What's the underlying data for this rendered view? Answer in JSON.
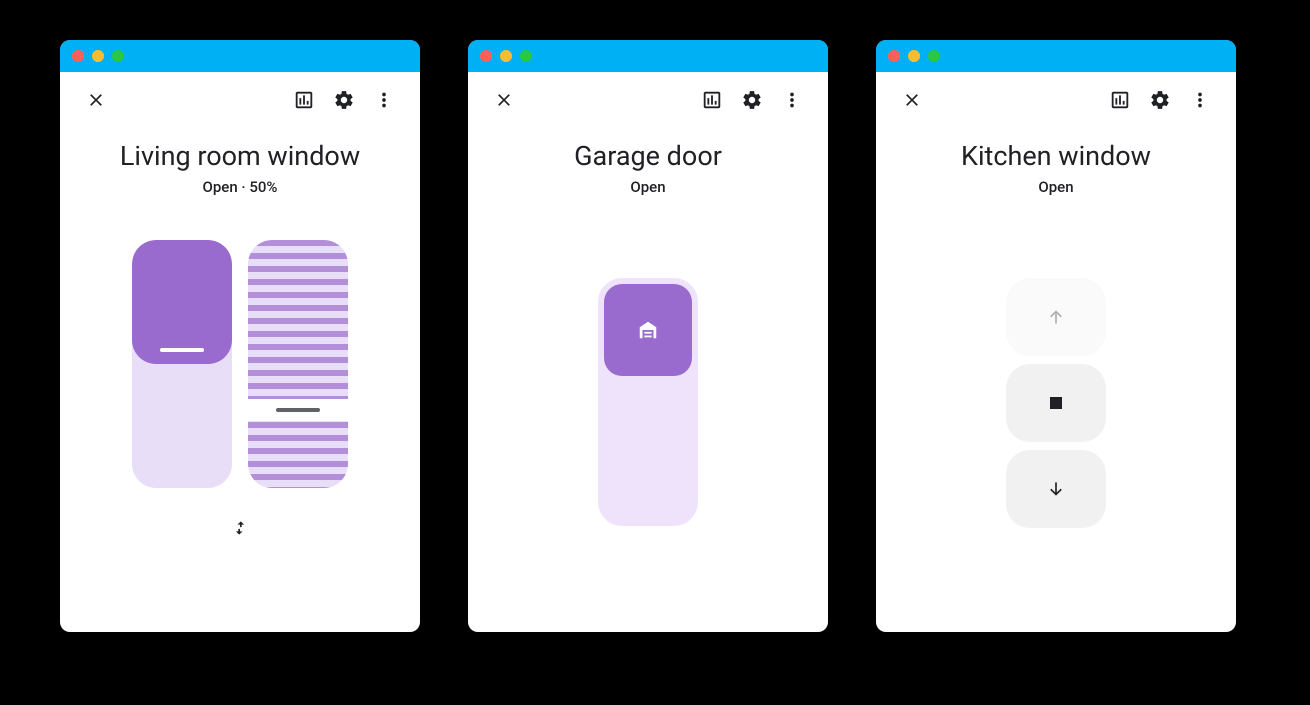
{
  "panels": [
    {
      "title": "Living room window",
      "status": "Open · 50%"
    },
    {
      "title": "Garage door",
      "status": "Open"
    },
    {
      "title": "Kitchen window",
      "status": "Open"
    }
  ]
}
